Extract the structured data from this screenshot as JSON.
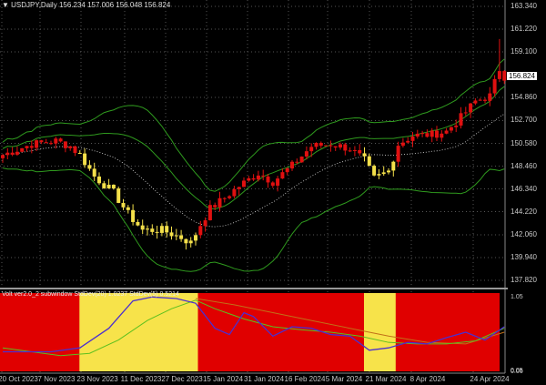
{
  "header": {
    "symbol_menu_icon": "triangle-down-icon",
    "title": "USDJPY,Daily",
    "open": "156.234",
    "high": "157.006",
    "low": "156.048",
    "close": "156.824"
  },
  "price_axis": [
    "163.340",
    "161.220",
    "159.100",
    "154.860",
    "152.700",
    "150.580",
    "148.460",
    "146.340",
    "144.220",
    "142.060",
    "139.940",
    "137.820"
  ],
  "current_price": "156.824",
  "sub_axis": [
    "1.05",
    "0.05",
    "0.06"
  ],
  "subwindow": {
    "label": "Volt ver2.0_2 subwindow  StdDev(20) 1.0237  StdDev(5) 0.5214"
  },
  "date_axis": [
    "20 Oct 2023",
    "7 Nov 2023",
    "23 Nov 2023",
    "11 Dec 2023",
    "27 Dec 2023",
    "15 Jan 2024",
    "31 Jan 2024",
    "16 Feb 2024",
    "5 Mar 2024",
    "21 Mar 2024",
    "8 Apr 2024",
    "24 Apr 2024"
  ],
  "colors": {
    "up": "#e01010",
    "yellow": "#f4e04a",
    "band": "#2f9a1e",
    "sub_bg": "#e00000",
    "sub_yellow": "#f7e34a",
    "blue": "#4b2fd0",
    "green": "#5cc01f",
    "orange": "#c27018"
  },
  "chart_data": {
    "type": "candlestick",
    "price_range": [
      137.82,
      163.34
    ],
    "bars": 105,
    "close_keypoints": [
      [
        0,
        149.5
      ],
      [
        6,
        150.5
      ],
      [
        11,
        150.8
      ],
      [
        14,
        150.3
      ],
      [
        16,
        149.5
      ],
      [
        19,
        147.5
      ],
      [
        23,
        146
      ],
      [
        26,
        144
      ],
      [
        29,
        142.5
      ],
      [
        33,
        142.5
      ],
      [
        37,
        141.8
      ],
      [
        39,
        141.3
      ],
      [
        41,
        143
      ],
      [
        43,
        144.5
      ],
      [
        46,
        145.5
      ],
      [
        49,
        146.6
      ],
      [
        53,
        147.8
      ],
      [
        56,
        147
      ],
      [
        60,
        148.5
      ],
      [
        64,
        150.3
      ],
      [
        68,
        150.5
      ],
      [
        72,
        150.1
      ],
      [
        75,
        149
      ],
      [
        77,
        147.3
      ],
      [
        80,
        148
      ],
      [
        82,
        150.5
      ],
      [
        85,
        151.3
      ],
      [
        89,
        151.4
      ],
      [
        92,
        151.7
      ],
      [
        95,
        153
      ],
      [
        98,
        154.5
      ],
      [
        101,
        155
      ],
      [
        103,
        157.5
      ],
      [
        104,
        156.8
      ]
    ],
    "yellow_zones": [
      [
        16,
        40
      ],
      [
        75,
        81
      ]
    ],
    "sub_series": {
      "blue": [
        [
          0,
          0.3
        ],
        [
          10,
          0.3
        ],
        [
          16,
          0.35
        ],
        [
          22,
          0.6
        ],
        [
          27,
          0.95
        ],
        [
          31,
          1.0
        ],
        [
          36,
          0.98
        ],
        [
          40,
          0.92
        ],
        [
          44,
          0.6
        ],
        [
          47,
          0.52
        ],
        [
          50,
          0.8
        ],
        [
          52,
          0.75
        ],
        [
          56,
          0.5
        ],
        [
          60,
          0.62
        ],
        [
          64,
          0.6
        ],
        [
          68,
          0.52
        ],
        [
          72,
          0.5
        ],
        [
          76,
          0.32
        ],
        [
          80,
          0.35
        ],
        [
          84,
          0.42
        ],
        [
          88,
          0.4
        ],
        [
          92,
          0.48
        ],
        [
          96,
          0.55
        ],
        [
          100,
          0.45
        ],
        [
          104,
          0.62
        ]
      ],
      "green": [
        [
          0,
          0.35
        ],
        [
          12,
          0.25
        ],
        [
          18,
          0.28
        ],
        [
          24,
          0.45
        ],
        [
          30,
          0.7
        ],
        [
          35,
          0.85
        ],
        [
          40,
          0.96
        ],
        [
          44,
          0.85
        ],
        [
          50,
          0.72
        ],
        [
          56,
          0.62
        ],
        [
          62,
          0.58
        ],
        [
          68,
          0.55
        ],
        [
          74,
          0.5
        ],
        [
          80,
          0.42
        ],
        [
          86,
          0.4
        ],
        [
          92,
          0.4
        ],
        [
          98,
          0.44
        ],
        [
          104,
          0.6
        ]
      ],
      "orange": [
        [
          40,
          0.98
        ],
        [
          48,
          0.9
        ],
        [
          56,
          0.8
        ],
        [
          64,
          0.7
        ],
        [
          72,
          0.6
        ],
        [
          80,
          0.5
        ],
        [
          88,
          0.42
        ],
        [
          96,
          0.4
        ],
        [
          104,
          0.55
        ]
      ]
    },
    "sub_range": [
      0.05,
      1.05
    ]
  }
}
